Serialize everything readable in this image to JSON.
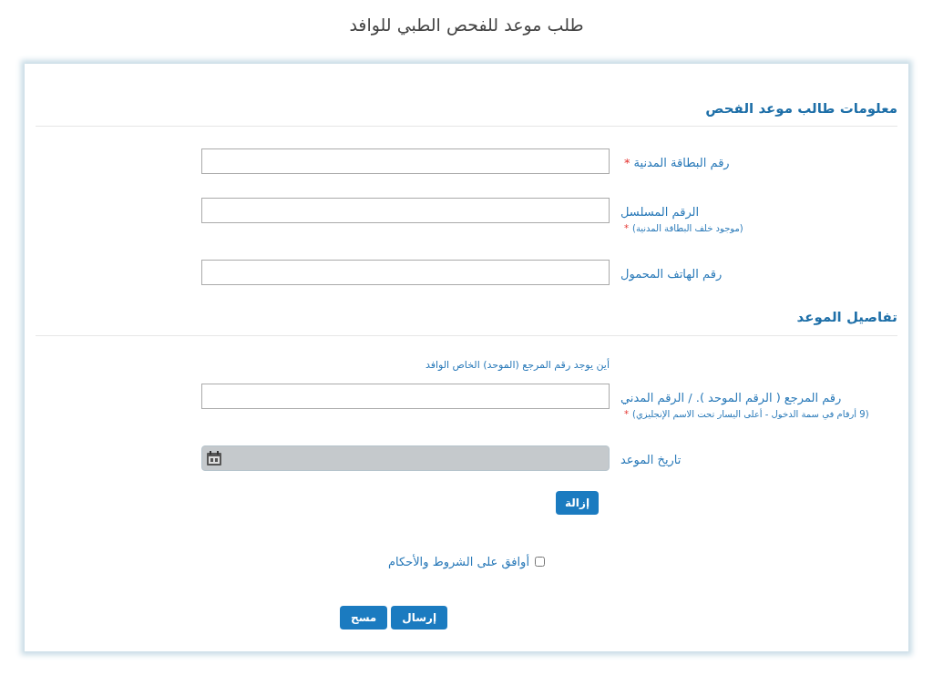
{
  "page_title": "طلب موعد للفحص الطبي للوافد",
  "sections": [
    {
      "title": "معلومات طالب موعد الفحص",
      "fields": [
        {
          "kind": "text",
          "label": "رقم البطاقة المدنية",
          "required_mark": "*"
        },
        {
          "kind": "text",
          "label": "الرقم المسلسل",
          "hint": "(موجود خلف البطاقة المدنية)",
          "required_mark": "*"
        },
        {
          "kind": "text",
          "label": "رقم الهاتف المحمول"
        }
      ]
    },
    {
      "title": "تفاصيل الموعد",
      "fields": [
        {
          "kind": "text",
          "label": "رقم المرجع ( الرقم الموحد ). / الرقم المدني",
          "hint": "(9 أرقام في سمة الدخول - أعلى اليسار تحت الاسم الإنجليزي)",
          "help_link": "أين يوجد رقم المرجع (الموحد) الخاص الوافد",
          "required_mark": "*"
        },
        {
          "kind": "date",
          "label": "تاريخ الموعد",
          "disabled": true
        }
      ],
      "action": "إزالة"
    }
  ],
  "terms": {
    "label": "أوافق على الشروط والأحكام",
    "checked": false
  },
  "buttons": [
    "إرسال",
    "مسح"
  ]
}
